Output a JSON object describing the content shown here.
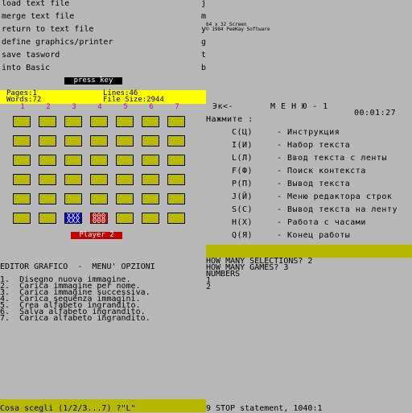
{
  "top_menu": [
    {
      "label": "load text file",
      "key": "j"
    },
    {
      "label": "merge text file",
      "key": "m"
    },
    {
      "label": "return to text file",
      "key": "y"
    },
    {
      "label": "define graphics/printer",
      "key": "g"
    },
    {
      "label": "save tasword",
      "key": "t"
    },
    {
      "label": "into Basic",
      "key": "b"
    }
  ],
  "brand": {
    "line1": "64 x 32 Screen",
    "line2": "© 1984 PeeKay Software"
  },
  "press_key": "press key",
  "info": {
    "pages": "Pages:1",
    "lines": "Lines:46",
    "words": "Words:72",
    "filesize": "File Size:2944"
  },
  "columns": [
    "1",
    "2",
    "3",
    "4",
    "5",
    "6",
    "7"
  ],
  "grid": {
    "blue_mark": "XXX\nXXX",
    "red_mark": "000\n000"
  },
  "player_label": "Player 2",
  "ru_menu": {
    "header_left": "Эк<-",
    "header_title": "М Е Н Ю - 1",
    "time": "00:01:27",
    "prompt": "Нажмите :",
    "items": [
      {
        "key": "C(Ц)",
        "text": "- Инструкция"
      },
      {
        "key": "I(И)",
        "text": "- Набор текста"
      },
      {
        "key": "L(Л)",
        "text": "- Ввод текста с ленты"
      },
      {
        "key": "F(Ф)",
        "text": "- Поиск контекста"
      },
      {
        "key": "P(П)",
        "text": "- Вывод текста"
      },
      {
        "key": "J(Й)",
        "text": "- Меню редактора строк"
      },
      {
        "key": "S(C)",
        "text": "- Вывод текста на ленту"
      },
      {
        "key": "H(X)",
        "text": "- Работа с часами"
      },
      {
        "key": "Q(Я)",
        "text": "- Конец работы"
      }
    ]
  },
  "selections": {
    "line1": "HOW MANY SELECTIONS? 2",
    "line2": "HOW MANY GAMES? 3",
    "line3": "NUMBERS",
    "line4": "1",
    "line5": "2"
  },
  "editor": {
    "title": "EDITOR GRAFICO  -  MENU' OPZIONI",
    "items": [
      "1.  Disegno nuova immagine.",
      "2.  Carica immagine per nome.",
      "3.  Carica immagine successiva.",
      "4.  Carica sequenza immagini.",
      "5.  Crea alfabeto ingrandito.",
      "6.  Salva alfabeto ingrandito.",
      "7.  Carica alfabeto ingrandito."
    ]
  },
  "bottom_left": "Cosa scegli (1/2/3...7) ?\"L\"",
  "bottom_right": "9 STOP statement, 1040:1",
  "colors": {
    "background": "#b8b8b8",
    "yellow": "#ffff00",
    "olive": "#b8b800",
    "blue": "#0000d8",
    "red": "#d80000",
    "magenta": "#c000c0"
  }
}
